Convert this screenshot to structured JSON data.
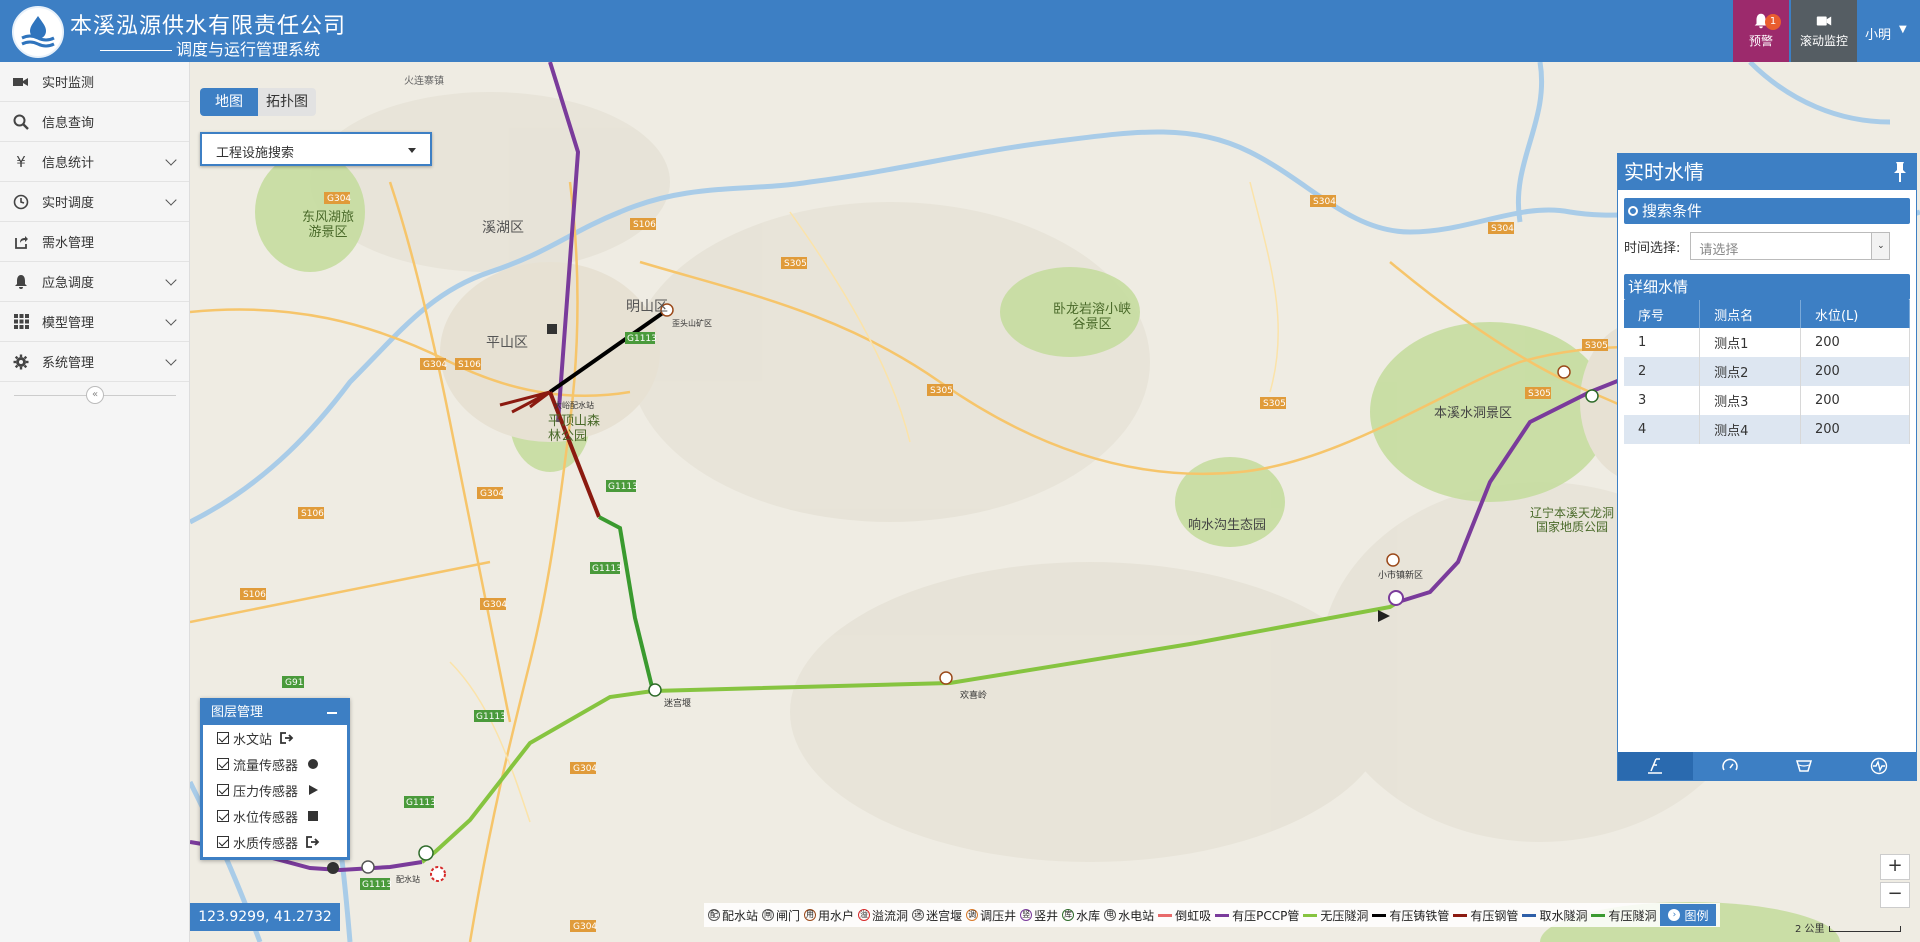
{
  "header": {
    "company": "本溪泓源供水有限责任公司",
    "system": "调度与运行管理系统",
    "alarm_label": "预警",
    "alarm_count": "1",
    "video_label": "滚动监控",
    "user_name": "小明"
  },
  "sidebar": {
    "items": [
      {
        "label": "实时监测",
        "icon": "video-icon"
      },
      {
        "label": "信息查询",
        "icon": "search-icon"
      },
      {
        "label": "信息统计",
        "icon": "yen-icon"
      },
      {
        "label": "实时调度",
        "icon": "clock-icon"
      },
      {
        "label": "需水管理",
        "icon": "share-icon"
      },
      {
        "label": "应急调度",
        "icon": "bell-icon"
      },
      {
        "label": "模型管理",
        "icon": "grid-icon"
      },
      {
        "label": "系统管理",
        "icon": "gear-icon"
      }
    ]
  },
  "map": {
    "tabs": [
      "地图",
      "拓扑图"
    ],
    "active_tab": "地图",
    "search_label": "工程设施搜索",
    "coordinate": "123.9299, 41.2732",
    "scale_label": "2 公里",
    "places": [
      {
        "name": "火连寨镇"
      },
      {
        "name": "东风湖旅游景区"
      },
      {
        "name": "溪湖区"
      },
      {
        "name": "明山区"
      },
      {
        "name": "平山区"
      },
      {
        "name": "平顶山森林公园"
      },
      {
        "name": "卧龙岩溶小峡谷景区"
      },
      {
        "name": "本溪水洞景区"
      },
      {
        "name": "响水沟生态园"
      },
      {
        "name": "辽宁本溪天龙洞国家地质公园"
      },
      {
        "name": "欢喜岭"
      },
      {
        "name": "迷宫堰"
      },
      {
        "name": "小市镇新区"
      },
      {
        "name": "大峪配水站"
      },
      {
        "name": "歪头山矿区"
      },
      {
        "name": "配水站"
      }
    ],
    "roads": [
      "G304",
      "S106",
      "S304",
      "S305",
      "G1113",
      "G91"
    ]
  },
  "layer_panel": {
    "title": "图层管理",
    "layers": [
      {
        "label": "水文站",
        "checked": true,
        "symbol": "sign-out-icon"
      },
      {
        "label": "流量传感器",
        "checked": true,
        "symbol": "dot-icon"
      },
      {
        "label": "压力传感器",
        "checked": true,
        "symbol": "triangle-icon"
      },
      {
        "label": "水位传感器",
        "checked": true,
        "symbol": "square-icon"
      },
      {
        "label": "水质传感器",
        "checked": true,
        "symbol": "sign-out-icon"
      }
    ]
  },
  "legend": {
    "items": [
      {
        "label": "配水站",
        "kind": "circle",
        "glyph": "配"
      },
      {
        "label": "闸门",
        "kind": "circle",
        "glyph": "闸"
      },
      {
        "label": "用水户",
        "kind": "circle",
        "glyph": "用"
      },
      {
        "label": "溢流洞",
        "kind": "circle",
        "glyph": "溢"
      },
      {
        "label": "迷宫堰",
        "kind": "circle",
        "glyph": "迷"
      },
      {
        "label": "调压井",
        "kind": "circle",
        "glyph": "调"
      },
      {
        "label": "竖井",
        "kind": "circle",
        "glyph": "竖"
      },
      {
        "label": "水库",
        "kind": "circle",
        "glyph": "库"
      },
      {
        "label": "水电站",
        "kind": "circle",
        "glyph": "电"
      },
      {
        "label": "倒虹吸",
        "kind": "line",
        "color": "#e86a6a"
      },
      {
        "label": "有压PCCP管",
        "kind": "line",
        "color": "#7a3b9b"
      },
      {
        "label": "无压隧洞",
        "kind": "line",
        "color": "#86c440"
      },
      {
        "label": "有压铸铁管",
        "kind": "line",
        "color": "#000000"
      },
      {
        "label": "有压钢管",
        "kind": "line",
        "color": "#8b1a10"
      },
      {
        "label": "取水隧洞",
        "kind": "line",
        "color": "#2e5fa8"
      },
      {
        "label": "有压隧洞",
        "kind": "line",
        "color": "#3a9a2f"
      }
    ],
    "button_label": "图例"
  },
  "water_panel": {
    "title": "实时水情",
    "search_section": "搜索条件",
    "time_label": "时间选择:",
    "time_placeholder": "请选择",
    "detail_section": "详细水情",
    "columns": [
      "序号",
      "测点名",
      "水位(L)"
    ],
    "rows": [
      [
        "1",
        "测点1",
        "200"
      ],
      [
        "2",
        "测点2",
        "200"
      ],
      [
        "3",
        "测点3",
        "200"
      ],
      [
        "4",
        "测点4",
        "200"
      ]
    ],
    "footer_tabs": [
      "water-level-icon",
      "gauge-icon",
      "basin-icon",
      "pulse-icon"
    ]
  },
  "colors": {
    "brand": "#3d7fc4",
    "alarm": "#9c2a6c",
    "video": "#555d63",
    "pccp": "#7a3b9b",
    "free_tunnel": "#86c440",
    "pressure_tunnel": "#3a9a2f",
    "cast_iron": "#000000",
    "steel": "#8b1a10"
  }
}
